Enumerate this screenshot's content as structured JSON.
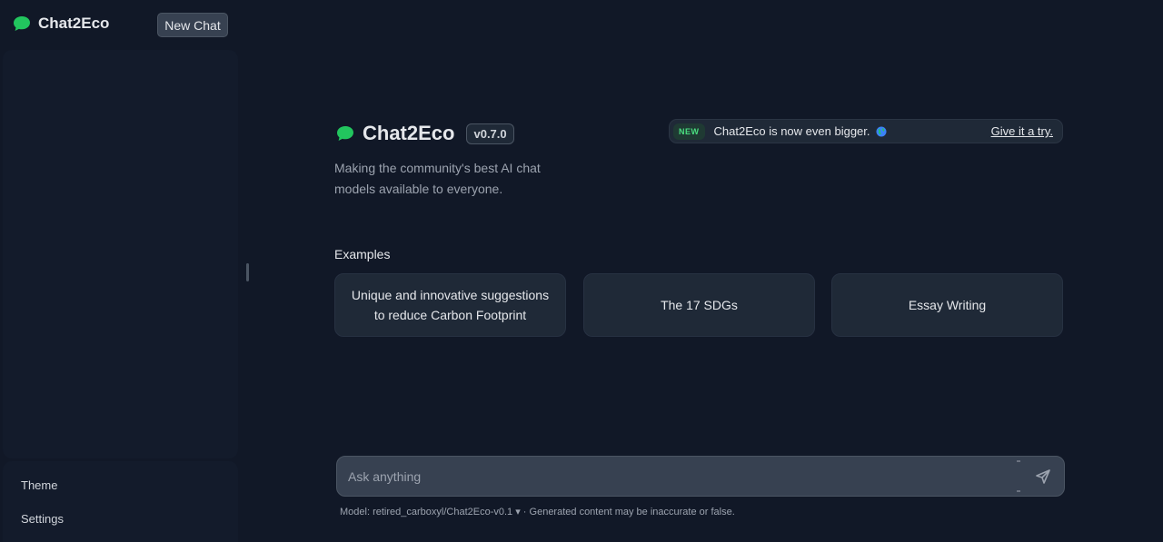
{
  "sidebar": {
    "brand_name": "Chat2Eco",
    "new_chat_label": "New Chat",
    "theme_label": "Theme",
    "settings_label": "Settings"
  },
  "main": {
    "title": "Chat2Eco",
    "version": "v0.7.0",
    "tagline": "Making the community's best AI chat models available to everyone.",
    "announcement": {
      "badge": "NEW",
      "text": "Chat2Eco is now even bigger.",
      "link": "Give it a try."
    },
    "examples_label": "Examples",
    "examples": [
      "Unique and innovative suggestions to reduce Carbon Footprint",
      "The 17 SDGs",
      "Essay Writing"
    ]
  },
  "input": {
    "placeholder": "Ask anything"
  },
  "footer": {
    "model_prefix": "Model: ",
    "model_name": "retired_carboxyl/Chat2Eco-v0.1",
    "caret": "▾",
    "disclaimer": " · Generated content may be inaccurate or false."
  },
  "colors": {
    "background": "#111827",
    "accent_green": "#22c55e",
    "card": "#1f2937"
  }
}
